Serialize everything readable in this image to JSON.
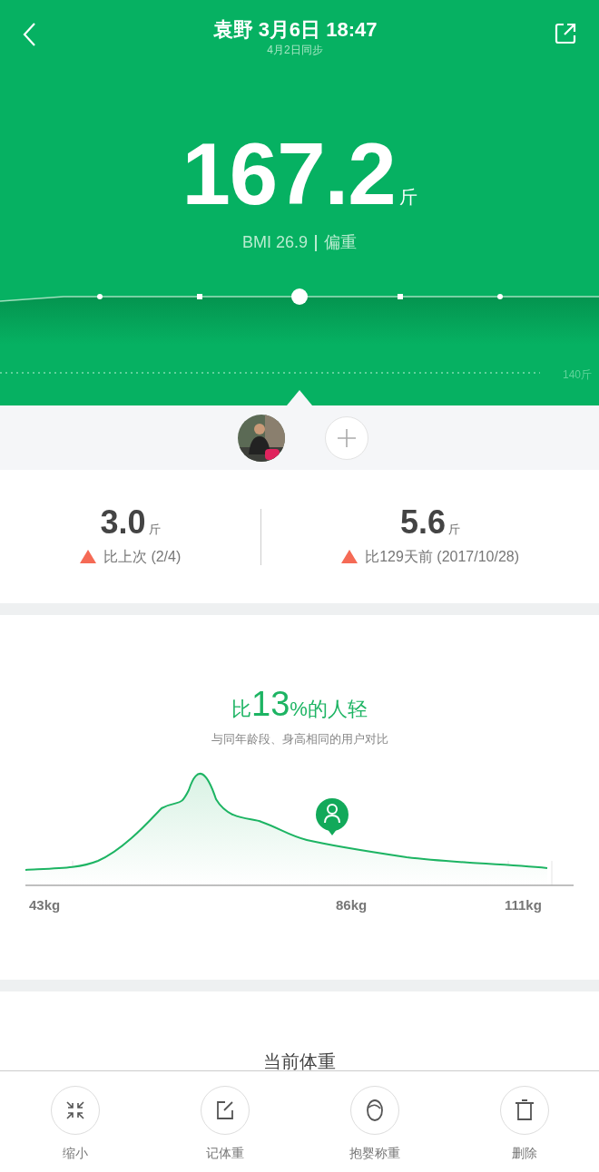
{
  "header": {
    "title": "袁野 3月6日 18:47",
    "sync_note": "4月2日同步",
    "weight": "167.2",
    "unit": "斤",
    "bmi": "BMI 26.9",
    "bmi_status": "偏重",
    "reference_label": "140斤"
  },
  "comparisons": [
    {
      "value": "3.0",
      "unit": "斤",
      "increase": true,
      "text": "比上次 (2/4)"
    },
    {
      "value": "5.6",
      "unit": "斤",
      "increase": true,
      "text": "比129天前 (2017/10/28)"
    }
  ],
  "ranking": {
    "prefix": "比",
    "percent": "13",
    "suffix": "%的人轻",
    "subtitle": "与同年龄段、身高相同的用户对比",
    "axis_labels": [
      "43kg",
      "86kg",
      "111kg"
    ]
  },
  "current_section": {
    "title": "当前体重"
  },
  "actions": [
    {
      "kind": "shrink",
      "label": "缩小"
    },
    {
      "kind": "record",
      "label": "记体重"
    },
    {
      "kind": "baby",
      "label": "抱婴称重"
    },
    {
      "kind": "delete",
      "label": "删除"
    }
  ]
}
